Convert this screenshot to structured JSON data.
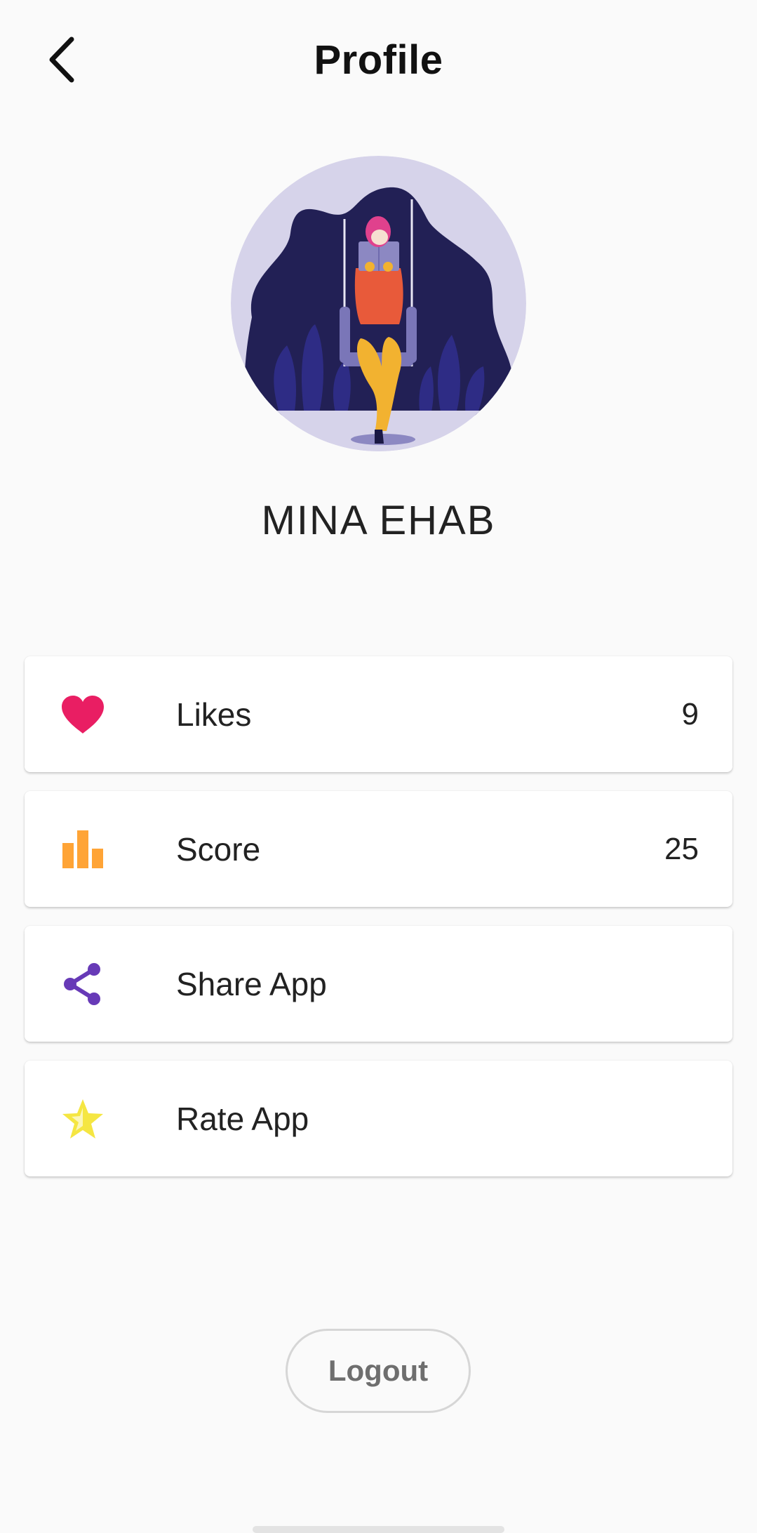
{
  "app_bar": {
    "title": "Profile",
    "back_icon": "chevron-left-icon"
  },
  "profile": {
    "name": "MINA EHAB",
    "avatar_icon": "illustration-girl-reading-on-swing"
  },
  "items": [
    {
      "label": "Likes",
      "value": "9",
      "icon": "heart-icon",
      "icon_color": "#e91e63"
    },
    {
      "label": "Score",
      "value": "25",
      "icon": "bar-chart-icon",
      "icon_color": "#ffa436"
    },
    {
      "label": "Share App",
      "value": "",
      "icon": "share-icon",
      "icon_color": "#673ab7"
    },
    {
      "label": "Rate App",
      "value": "",
      "icon": "star-icon",
      "icon_color": "#f5e642"
    }
  ],
  "logout": {
    "label": "Logout"
  }
}
